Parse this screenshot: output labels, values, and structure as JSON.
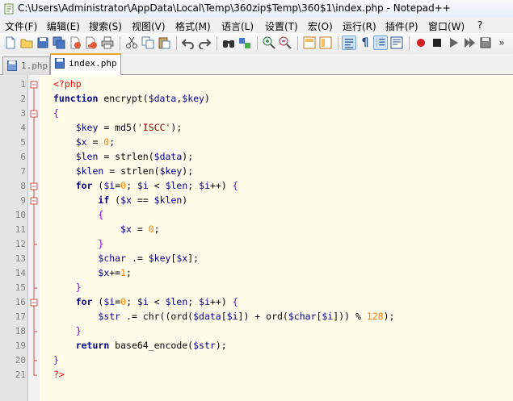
{
  "window": {
    "title": "C:\\Users\\Administrator\\AppData\\Local\\Temp\\360zip$Temp\\360$1\\index.php - Notepad++"
  },
  "menu": [
    "文件(F)",
    "编辑(E)",
    "搜索(S)",
    "视图(V)",
    "格式(M)",
    "语言(L)",
    "设置(T)",
    "宏(O)",
    "运行(R)",
    "插件(P)",
    "窗口(W)",
    "?"
  ],
  "tabs": [
    {
      "label": "1.php",
      "active": false
    },
    {
      "label": "index.php",
      "active": true
    }
  ],
  "editor": {
    "line_numbers": [
      "1",
      "2",
      "3",
      "4",
      "5",
      "6",
      "7",
      "8",
      "9",
      "10",
      "11",
      "12",
      "13",
      "14",
      "15",
      "16",
      "17",
      "18",
      "19",
      "20",
      "21"
    ]
  },
  "colors": {
    "editor_bg": "#fffce9",
    "keyword": "#00008b",
    "string": "#8b0000",
    "number": "#ff8000",
    "php_tag": "#ff0000",
    "active_tab_accent": "#f4a91d"
  }
}
